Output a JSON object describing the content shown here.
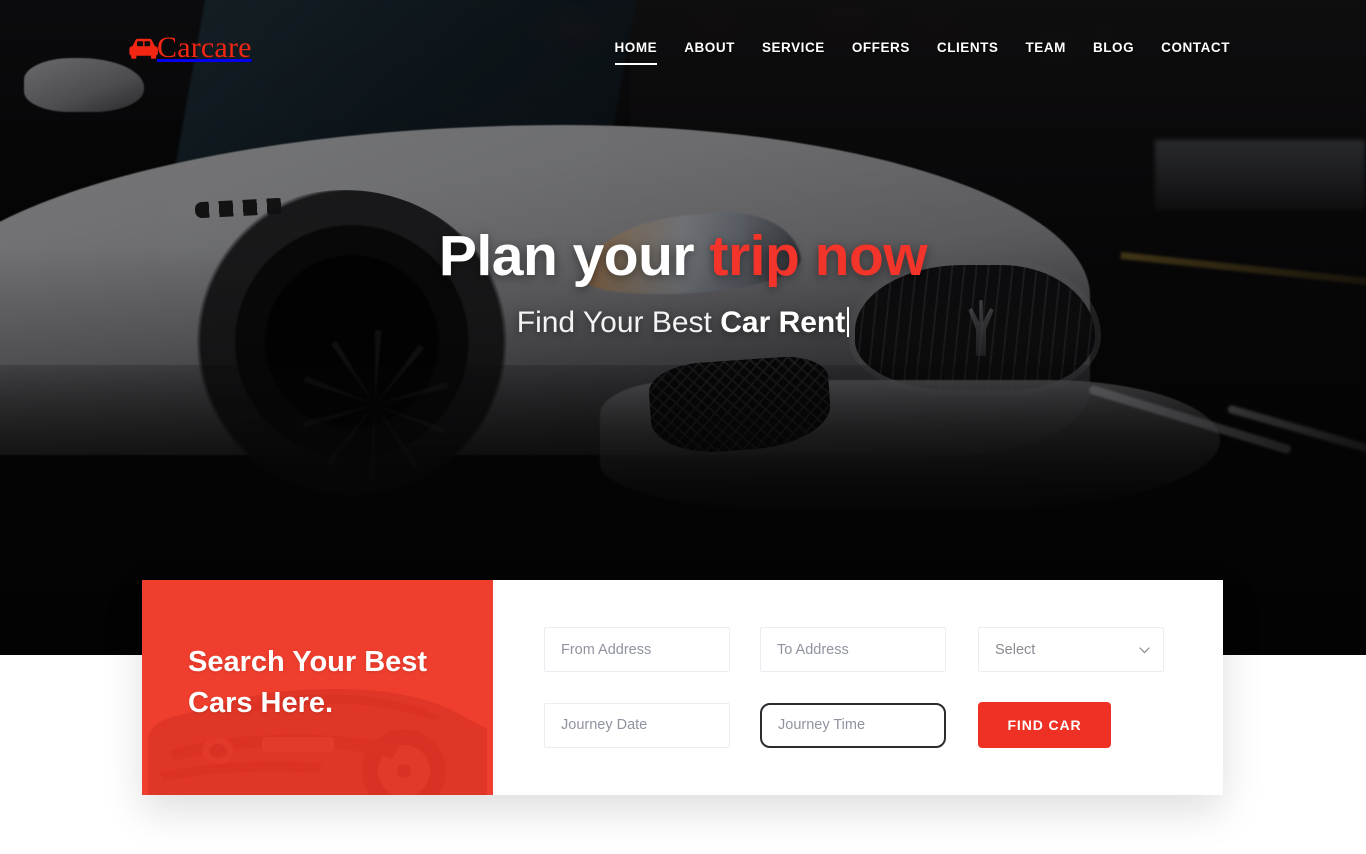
{
  "brand": {
    "name": "Carcare",
    "logo_icon": "car-icon",
    "accent_color": "#F22613"
  },
  "nav": {
    "items": [
      {
        "label": "HOME",
        "active": true
      },
      {
        "label": "ABOUT",
        "active": false
      },
      {
        "label": "SERVICE",
        "active": false
      },
      {
        "label": "OFFERS",
        "active": false
      },
      {
        "label": "CLIENTS",
        "active": false
      },
      {
        "label": "TEAM",
        "active": false
      },
      {
        "label": "BLOG",
        "active": false
      },
      {
        "label": "CONTACT",
        "active": false
      }
    ]
  },
  "hero": {
    "title_plain": "Plan your ",
    "title_accent": "trip now",
    "subtitle_plain": "Find Your Best ",
    "subtitle_strong": "Car Rent",
    "accent_color": "#F2342A",
    "background": "dark-city-street-with-white-car-photo"
  },
  "search": {
    "panel_title_line1": "Search Your Best",
    "panel_title_line2": "Cars Here.",
    "panel_color": "#EF3E2E",
    "panel_image": "red-car-silhouette",
    "fields": {
      "from_address": {
        "placeholder": "From Address",
        "value": ""
      },
      "to_address": {
        "placeholder": "To Address",
        "value": ""
      },
      "car_select": {
        "value": "Select",
        "arrow_icon": "chevron-down-icon"
      },
      "journey_date": {
        "placeholder": "Journey Date",
        "value": ""
      },
      "journey_time": {
        "placeholder": "Journey Time",
        "value": "",
        "focused": true
      }
    },
    "submit_label": "FIND CAR",
    "submit_color": "#EE3124"
  }
}
